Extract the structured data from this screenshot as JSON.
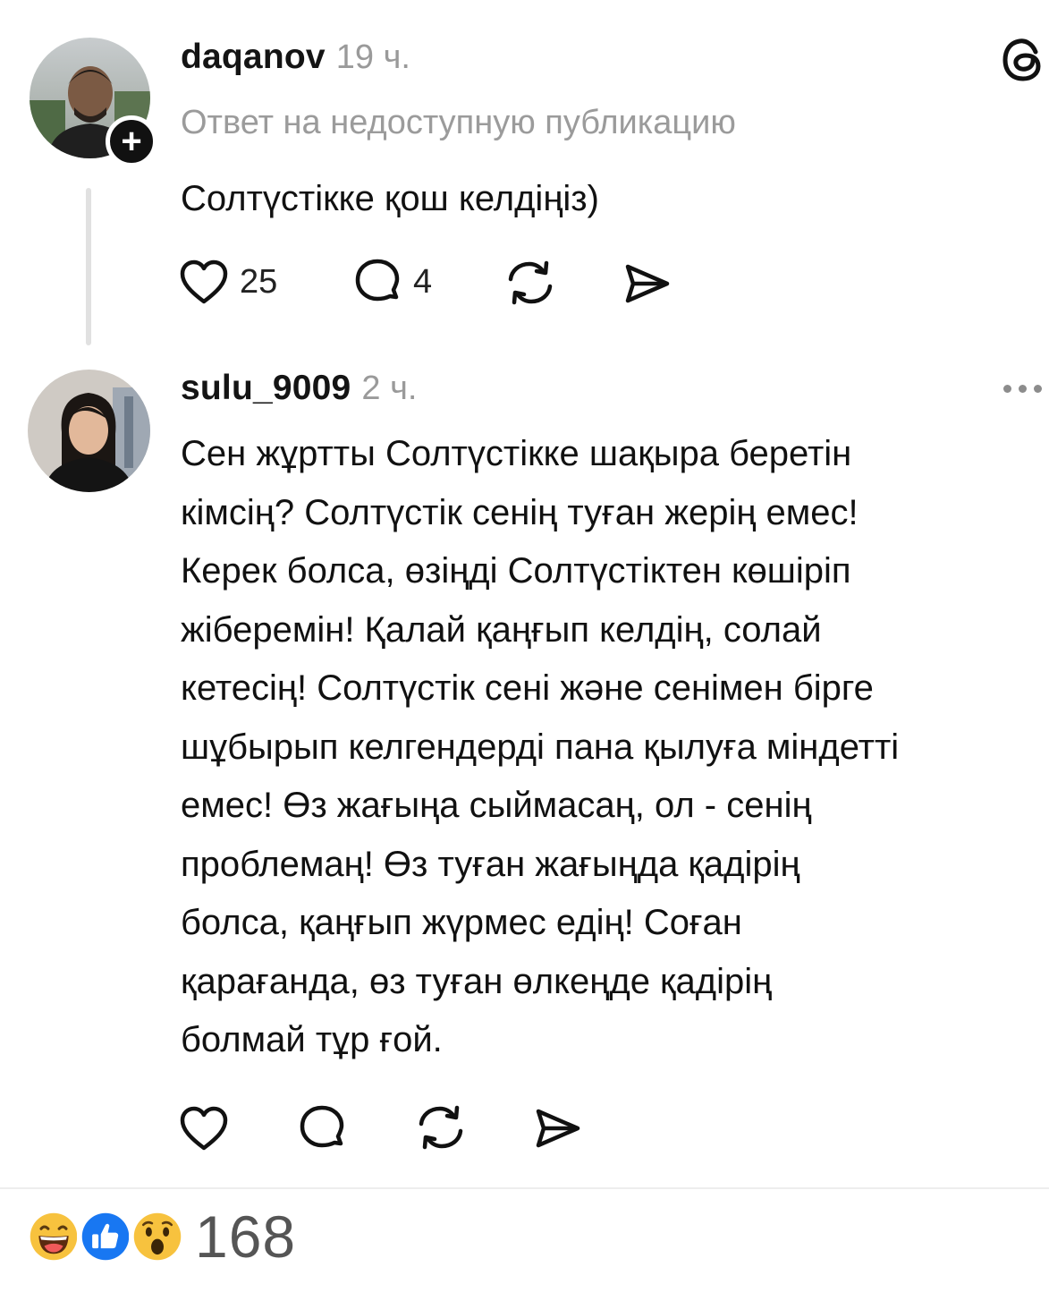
{
  "posts": [
    {
      "username": "daqanov",
      "time": "19 ч.",
      "reply_note": "Ответ на недоступную публикацию",
      "text": "Солтүстікке қош келдіңіз)",
      "likes": "25",
      "comments": "4",
      "avatar_icon": "user-avatar-man",
      "follow_icon": "plus-icon"
    },
    {
      "username": "sulu_9009",
      "time": "2 ч.",
      "text": "Сен жұртты Солтүстікке шақыра беретін\nкімсің? Солтүстік сенің туған жерің емес!\nКерек болса, өзіңді Солтүстіктен көшіріп\nжіберемін! Қалай қаңғып келдің, солай\nкетесің! Солтүстік сені және сенімен бірге\nшұбырып келгендерді пана қылуға міндетті\nемес! Өз жағыңа сыймасаң, ол - сенің\nпроблемаң! Өз туған жағыңда қадірің\nболса, қаңғып жүрмес едің! Соған\nқарағанда, өз туған өлкеңде қадірің\nболмай тұр ғой.",
      "avatar_icon": "user-avatar-woman",
      "more_icon": "ellipsis-icon"
    }
  ],
  "app_icon": "threads-logo-icon",
  "reactions": {
    "icons": [
      "laugh-emoji-icon",
      "like-emoji-icon",
      "wow-emoji-icon"
    ],
    "count": "168"
  },
  "colors": {
    "text": "#111111",
    "muted": "#9a9a9a",
    "thread_line": "#e1e1e1",
    "like_blue": "#1877f2",
    "emoji_yellow": "#f7c23e"
  }
}
